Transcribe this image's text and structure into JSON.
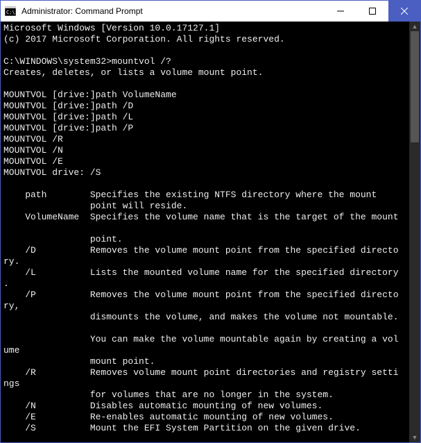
{
  "titlebar": {
    "title": "Administrator: Command Prompt"
  },
  "terminal": {
    "line1": "Microsoft Windows [Version 10.0.17127.1]",
    "line2": "(c) 2017 Microsoft Corporation. All rights reserved.",
    "blank1": "",
    "prompt_line": "C:\\WINDOWS\\system32>mountvol /?",
    "desc": "Creates, deletes, or lists a volume mount point.",
    "blank2": "",
    "syn1": "MOUNTVOL [drive:]path VolumeName",
    "syn2": "MOUNTVOL [drive:]path /D",
    "syn3": "MOUNTVOL [drive:]path /L",
    "syn4": "MOUNTVOL [drive:]path /P",
    "syn5": "MOUNTVOL /R",
    "syn6": "MOUNTVOL /N",
    "syn7": "MOUNTVOL /E",
    "syn8": "MOUNTVOL drive: /S",
    "blank3": "",
    "p_path1": "    path        Specifies the existing NTFS directory where the mount",
    "p_path2": "                point will reside.",
    "p_vol1": "    VolumeName  Specifies the volume name that is the target of the mount",
    "blank4": "",
    "p_vol2": "                point.",
    "p_d1": "    /D          Removes the volume mount point from the specified directo",
    "p_d2": "ry.",
    "p_l1": "    /L          Lists the mounted volume name for the specified directory",
    "p_l2": ".",
    "p_p1": "    /P          Removes the volume mount point from the specified directo",
    "p_p2": "ry,",
    "p_p3": "                dismounts the volume, and makes the volume not mountable.",
    "blank5": "",
    "p_p4": "                You can make the volume mountable again by creating a vol",
    "p_p5": "ume",
    "p_p6": "                mount point.",
    "p_r1": "    /R          Removes volume mount point directories and registry setti",
    "p_r2": "ngs",
    "p_r3": "                for volumes that are no longer in the system.",
    "p_n": "    /N          Disables automatic mounting of new volumes.",
    "p_e": "    /E          Re-enables automatic mounting of new volumes.",
    "p_s": "    /S          Mount the EFI System Partition on the given drive."
  }
}
